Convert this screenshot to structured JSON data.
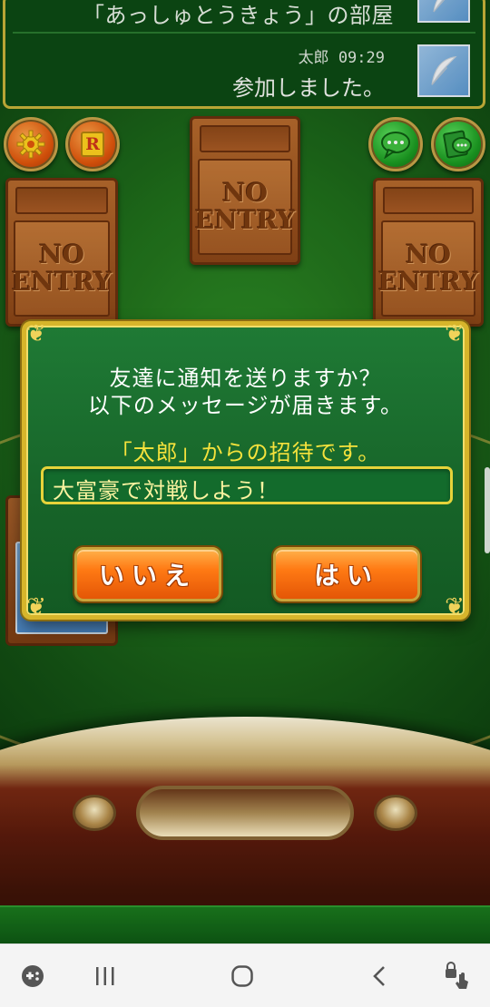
{
  "chat": {
    "room_title": "「あっしゅとうきょう」の部屋",
    "sender": "太郎",
    "time": "09:29",
    "message": "参加しました。"
  },
  "seats": {
    "no_entry_line1": "NO",
    "no_entry_line2": "ENTRY"
  },
  "dialog": {
    "line1": "友達に通知を送りますか？",
    "line2": "以下のメッセージが届きます。",
    "invite_text": "「太郎」からの招待です。",
    "message_value": "大富豪で対戦しよう！",
    "no_label": "いいえ",
    "yes_label": "はい"
  },
  "colors": {
    "dialog_border": "#d7b52b",
    "invite_text": "#f5e23c",
    "button_orange": "#ff7a14",
    "felt_green": "#1f6e1b"
  },
  "icons": {
    "settings": "gear-icon",
    "rules": "rules-r-icon",
    "chat": "chat-bubble-icon",
    "stamp": "stamp-chat-icon",
    "avatar": "feather-icon"
  },
  "navbar": {
    "items": [
      "game-launcher-icon",
      "recent-apps-icon",
      "home-icon",
      "back-icon",
      "touch-lock-icon"
    ]
  }
}
